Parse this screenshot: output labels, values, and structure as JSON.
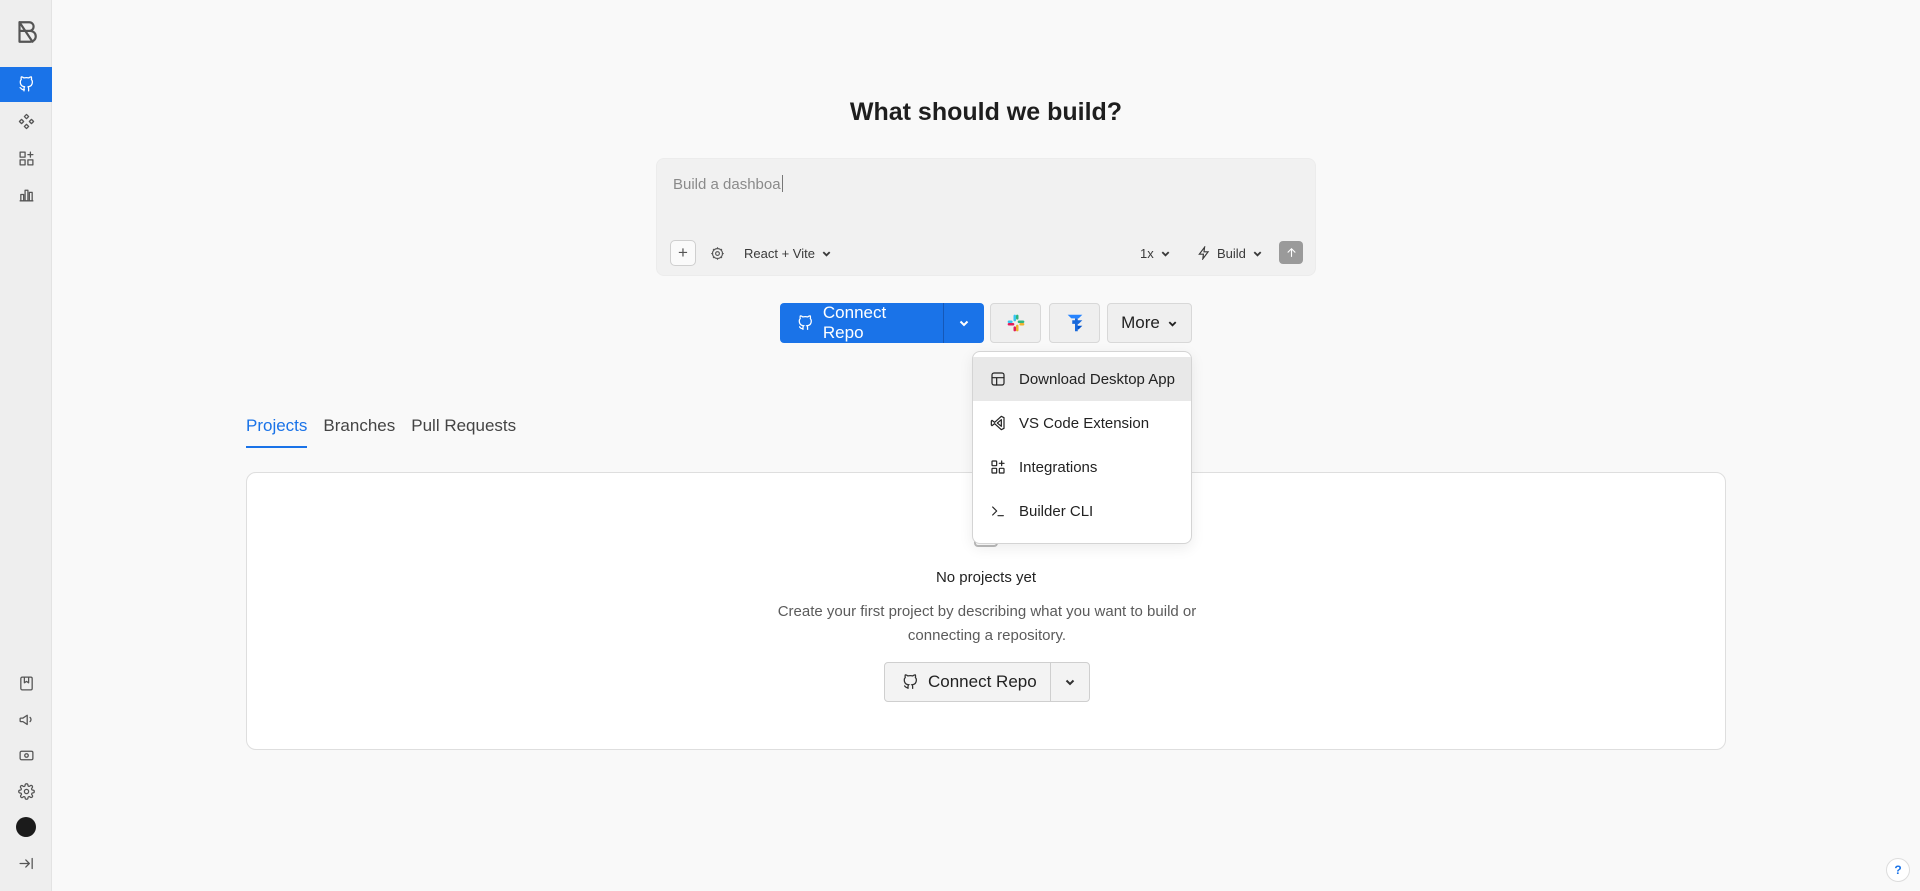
{
  "heading": "What should we build?",
  "prompt": {
    "text": "Build a dashboa",
    "framework": "React + Vite",
    "multiplier": "1x",
    "mode": "Build"
  },
  "actions": {
    "connect_repo": "Connect Repo",
    "more": "More"
  },
  "more_menu": [
    {
      "label": "Download Desktop App",
      "icon": "desktop-app-icon"
    },
    {
      "label": "VS Code Extension",
      "icon": "vscode-icon"
    },
    {
      "label": "Integrations",
      "icon": "integrations-icon"
    },
    {
      "label": "Builder CLI",
      "icon": "terminal-icon"
    }
  ],
  "tabs": [
    "Projects",
    "Branches",
    "Pull Requests"
  ],
  "empty_state": {
    "title": "No projects yet",
    "description": "Create your first project by describing what you want to build or connecting a repository.",
    "button": "Connect Repo"
  },
  "help": "?",
  "colors": {
    "accent": "#1a73e8",
    "sidebar": "#eeeeee"
  }
}
